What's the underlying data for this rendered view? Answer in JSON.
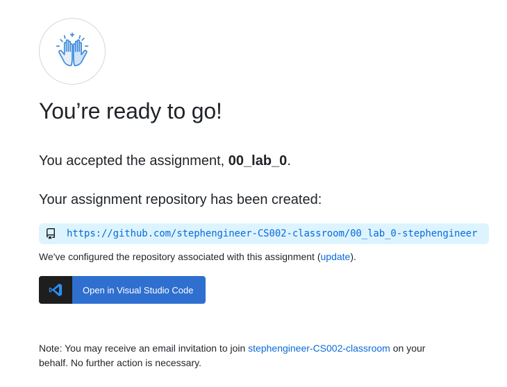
{
  "avatar": {
    "icon": "high-five-icon",
    "color": "#3d8bd9"
  },
  "title": "You’re ready to go!",
  "accepted": {
    "prefix": "You accepted the assignment, ",
    "assignment": "00_lab_0",
    "suffix": "."
  },
  "repo": {
    "heading": "Your assignment repository has been created:",
    "icon": "repo-icon",
    "url": "https://github.com/stephengineer-CS002-classroom/00_lab_0-stephengineer"
  },
  "configured": {
    "prefix": "We've configured the repository associated with this assignment (",
    "link": "update",
    "suffix": ")."
  },
  "vscode_button": {
    "label": "Open in Visual Studio Code",
    "icon": "vscode-icon"
  },
  "note": {
    "prefix": "Note: You may receive an email invitation to join ",
    "org_link": "stephengineer-CS002-classroom",
    "suffix": " on your behalf. No further action is necessary."
  },
  "colors": {
    "link": "#0969da",
    "repo_box_bg": "#ddf4ff",
    "button_bg": "#2f6fcf",
    "button_logo_bg": "#1e1e1e"
  }
}
